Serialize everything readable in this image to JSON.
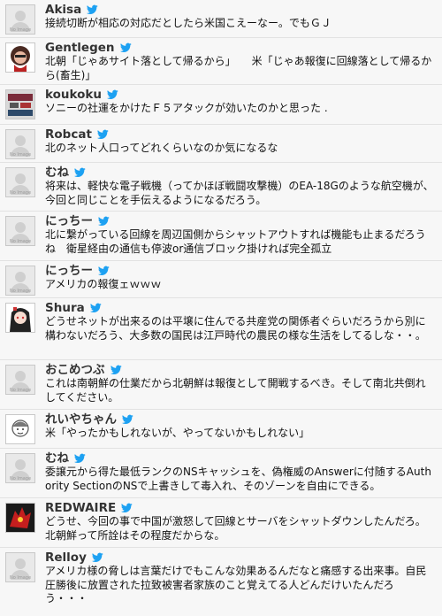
{
  "tweets": [
    {
      "name": "Akisa",
      "text": "接続切断が相応の対応だとしたら米国こえーなー。でもＧＪ",
      "avatar_text": "No Image"
    },
    {
      "name": "Gentlegen",
      "text": "北朝「じゃあサイト落として帰るから」　　米「じゃあ報復に回線落として帰るから(畜生)」",
      "avatar_text": ""
    },
    {
      "name": "koukoku",
      "text": "ソニーの社運をかけたＦ５アタックが効いたのかと思った .",
      "avatar_text": ""
    },
    {
      "name": "Robcat",
      "text": "北のネット人口ってどれくらいなのか気になるな",
      "avatar_text": "No Image"
    },
    {
      "name": "むね",
      "text": "将来は、軽快な電子戦機（ってかほぼ戦闘攻撃機）のEA-18Gのような航空機が、今回と同じことを手伝えるようになるだろう。",
      "avatar_text": "No Image"
    },
    {
      "name": "にっちー",
      "text": "北に繋がっている回線を周辺国側からシャットアウトすれば機能も止まるだろうね　衛星経由の通信も停波or通信ブロック掛ければ完全孤立",
      "avatar_text": "No Image"
    },
    {
      "name": "にっちー",
      "text": "アメリカの報復ェｗｗｗ",
      "avatar_text": "No Image"
    },
    {
      "name": "Shura",
      "text": "どうせネットが出来るのは平壌に住んでる共産党の関係者ぐらいだろうから別に構わないだろう、大多数の国民は江戸時代の農民の様な生活をしてるしな・・。",
      "avatar_text": ""
    },
    {
      "name": "おこめつぶ",
      "text": "これは南朝鮮の仕業だから北朝鮮は報復として開戦するべき。そして南北共倒れしてください。",
      "avatar_text": "No Image"
    },
    {
      "name": "れいやちゃん",
      "text": "米「やったかもしれないが、やってないかもしれない」",
      "avatar_text": ""
    },
    {
      "name": "むね",
      "text": "委譲元から得た最低ランクのNSキャッシュを、偽権威のAnswerに付随するAuthority SectionのNSで上書きして毒入れ、そのゾーンを自由にできる。",
      "avatar_text": "No Image"
    },
    {
      "name": "REDWAIRE",
      "text": "どうせ、今回の事で中国が激怒して回線とサーバをシャットダウンしたんだろ。北朝鮮って所詮はその程度だからな。",
      "avatar_text": ""
    },
    {
      "name": "Relloy",
      "text": "アメリカ様の脅しは言葉だけでもこんな効果あるんだなと痛感する出来事。自民圧勝後に放置された拉致被害者家族のこと覚えてる人どんだけいたんだろう・・・",
      "avatar_text": "No Image"
    }
  ],
  "colors": {
    "bird": "#1da1f2",
    "name": "#333333",
    "text": "#111111"
  },
  "icons": {
    "service": "twitter-bird-icon"
  }
}
